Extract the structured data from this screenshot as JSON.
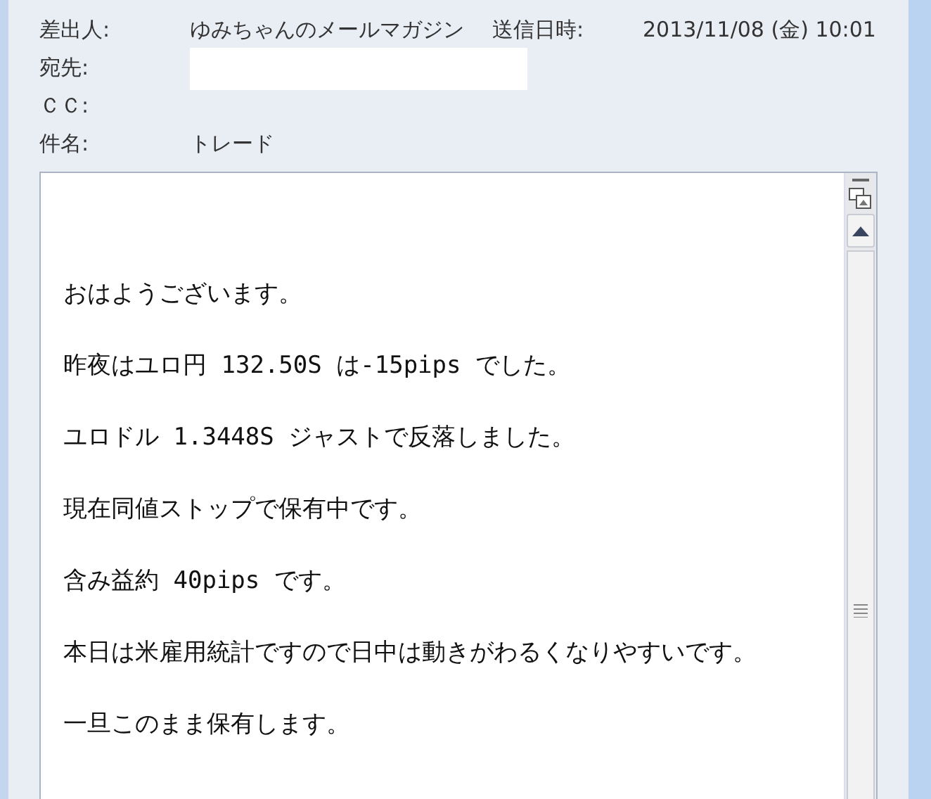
{
  "header": {
    "fields": [
      {
        "label": "差出人:",
        "value": "ゆみちゃんのメールマガジン",
        "extra_label": "送信日時:",
        "extra_value": "2013/11/08 (金) 10:01"
      },
      {
        "label": "宛先:",
        "kind": "redacted"
      },
      {
        "label": "ＣＣ:"
      },
      {
        "label": "件名:",
        "value": "トレード"
      }
    ]
  },
  "body": {
    "paragraphs": [
      "おはようございます。",
      "昨夜はユロ円 132.50S は-15pips でした。",
      "ユロドル 1.3448S ジャストで反落しました。",
      "現在同値ストップで保有中です。",
      "含み益約 40pips です。",
      "本日は米雇用統計ですので日中は動きがわるくなりやすいです。",
      "一旦このまま保有します。"
    ]
  }
}
